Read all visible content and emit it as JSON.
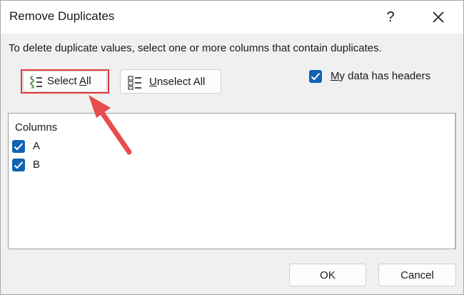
{
  "dialog": {
    "title": "Remove Duplicates",
    "help_label": "?",
    "instruction": "To delete duplicate values, select one or more columns that contain duplicates."
  },
  "buttons": {
    "select_all_prefix": "Select ",
    "select_all_mnemonic": "A",
    "select_all_suffix": "ll",
    "unselect_all_mnemonic": "U",
    "unselect_all_rest": "nselect All",
    "ok": "OK",
    "cancel": "Cancel"
  },
  "headers_option": {
    "mnemonic": "M",
    "rest": "y data has headers",
    "checked": true
  },
  "columns": {
    "header": "Columns",
    "items": [
      {
        "label": "A",
        "checked": true
      },
      {
        "label": "B",
        "checked": true
      }
    ]
  },
  "colors": {
    "accent": "#0f63b3",
    "highlight": "#e03a3a"
  }
}
